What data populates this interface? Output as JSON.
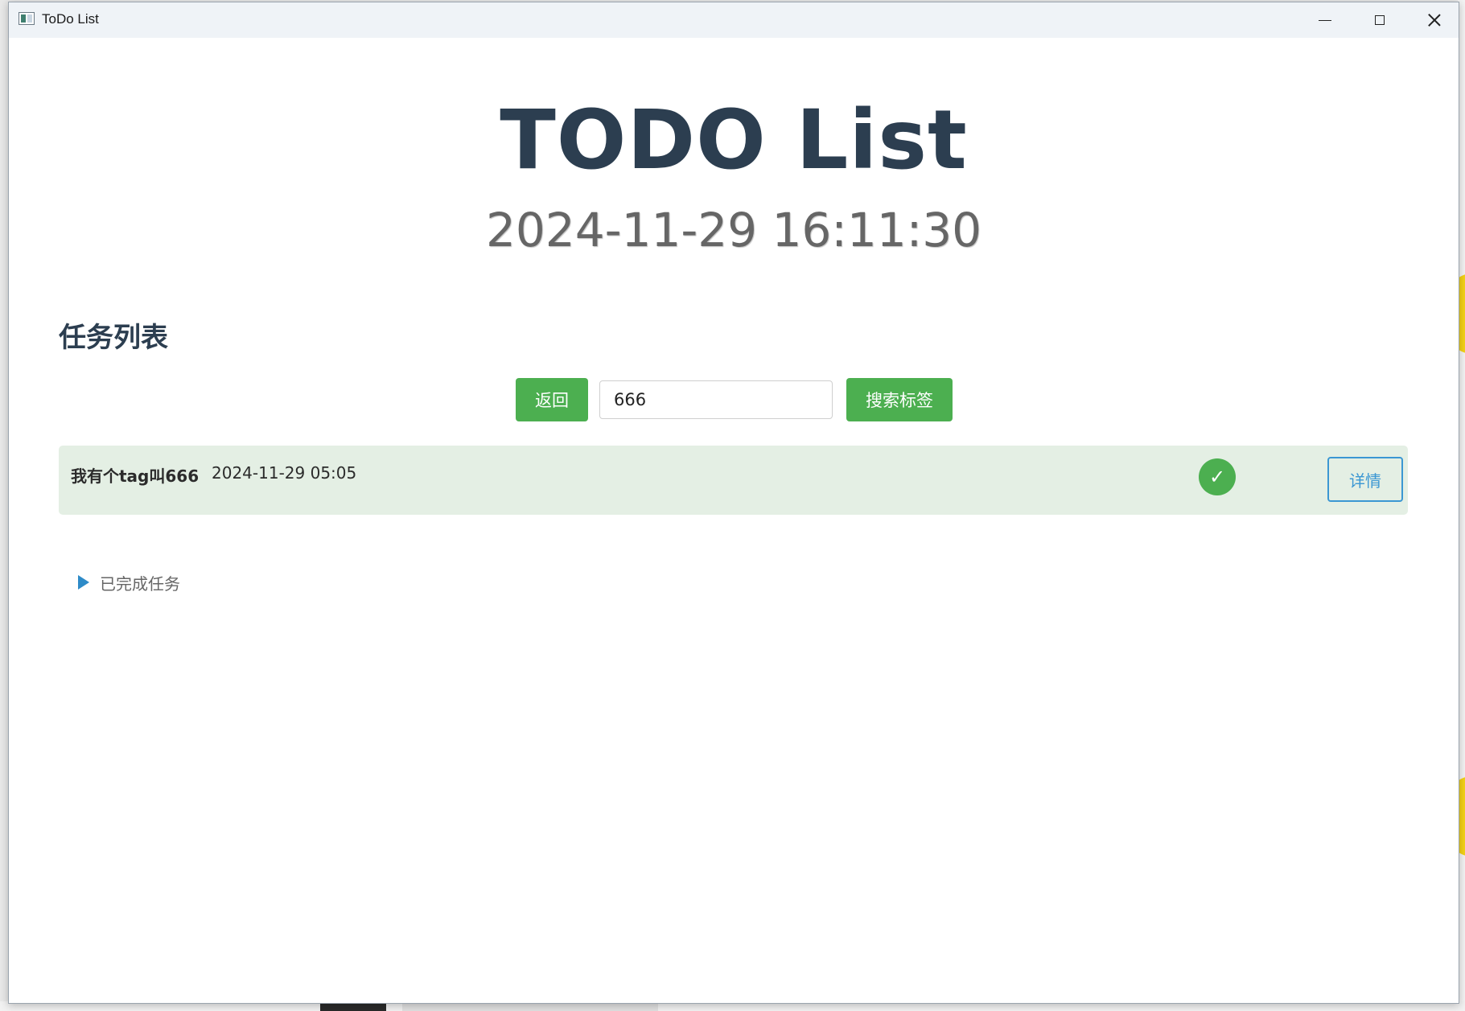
{
  "window": {
    "title": "ToDo List"
  },
  "header": {
    "title": "TODO List",
    "clock": "2024-11-29 16:11:30"
  },
  "section": {
    "title": "任务列表"
  },
  "toolbar": {
    "back_label": "返回",
    "search_value": "666",
    "search_tag_label": "搜索标签"
  },
  "tasks": [
    {
      "title": "我有个tag叫666",
      "date": "2024-11-29 05:05",
      "complete_icon": "✓",
      "detail_label": "详情"
    }
  ],
  "completed": {
    "label": "已完成任务"
  },
  "colors": {
    "primary_green": "#4caf50",
    "heading": "#2c3e50",
    "detail_blue": "#3b97d3",
    "task_bg": "#e4efe4"
  }
}
